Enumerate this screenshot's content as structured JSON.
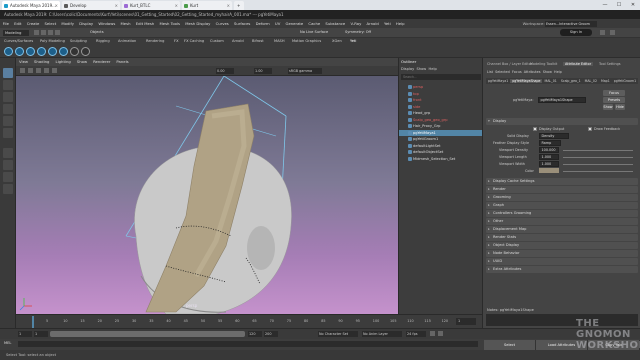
{
  "browser": {
    "tabs": [
      {
        "label": "Autodesk Maya 2019...",
        "color": "#1c9cc9",
        "active": true
      },
      {
        "label": "Develop",
        "color": "#5a5a5a",
        "active": false
      },
      {
        "label": "Kurt_BTLC",
        "color": "#9b6ad4",
        "active": false
      },
      {
        "label": "Kurt",
        "color": "#4a9b4a",
        "active": false
      }
    ],
    "controls": [
      "—",
      "☐",
      "✕"
    ]
  },
  "maya": {
    "title": "Autodesk Maya 2019: C:\\Users\\colic\\Documents\\Kurt\\Yeti\\scenes\\01_Getting_Started\\02_Getting_Started_myhairA_001.ma* --- pgYetiMaya1",
    "menu": [
      "File",
      "Edit",
      "Create",
      "Select",
      "Modify",
      "Display",
      "Windows",
      "Mesh",
      "Edit Mesh",
      "Mesh Tools",
      "Mesh Display",
      "Curves",
      "Surfaces",
      "Deform",
      "UV",
      "Generate",
      "Cache",
      "Substance",
      "V-Ray",
      "Arnold",
      "Yeti",
      "Help"
    ],
    "workspace_label": "Workspace:",
    "workspace_value": "Essen...Interactive Groom",
    "sign_in": "Sign In",
    "mode": "Modeling",
    "objects_label": "Objects",
    "no_live_surface": "No Live Surface",
    "symmetry": "Symmetry: Off",
    "shelf_tabs": [
      "Curves/Surfaces",
      "Poly Modeling",
      "Sculpting",
      "Rigging",
      "Animation",
      "Rendering",
      "FX",
      "FX Caching",
      "Custom",
      "Arnold",
      "Bifrost",
      "MASH",
      "Motion Graphics",
      "XGen",
      "Yeti"
    ]
  },
  "viewport": {
    "menu": [
      "View",
      "Shading",
      "Lighting",
      "Show",
      "Renderer",
      "Panels"
    ],
    "label": "persp",
    "colorspace": "sRGB gamma",
    "field_a": "0.00",
    "field_b": "1.00"
  },
  "outliner": {
    "title": "Outliner",
    "menu": [
      "Display",
      "Show",
      "Help"
    ],
    "search_placeholder": "Search...",
    "items": [
      {
        "label": "persp",
        "red": true,
        "selected": false
      },
      {
        "label": "top",
        "red": true,
        "selected": false
      },
      {
        "label": "front",
        "red": true,
        "selected": false
      },
      {
        "label": "side",
        "red": true,
        "selected": false
      },
      {
        "label": "Head_grp",
        "red": false,
        "selected": false
      },
      {
        "label": "Scalp_geo_geo_grp",
        "red": true,
        "selected": false
      },
      {
        "label": "Hair_Proxy_Grp",
        "red": false,
        "selected": false
      },
      {
        "label": "pgYetiMaya1",
        "red": false,
        "selected": true
      },
      {
        "label": "pgYetiGroom1",
        "red": false,
        "selected": false
      },
      {
        "label": "defaultLightSet",
        "red": false,
        "selected": false
      },
      {
        "label": "defaultObjectSet",
        "red": false,
        "selected": false
      },
      {
        "label": "Midmesh_Selection_Set",
        "red": false,
        "selected": false
      }
    ]
  },
  "attribute_editor": {
    "tabs": [
      "Channel Box / Layer Editor",
      "Modeling Toolkit",
      "Attribute Editor",
      "Tool Settings"
    ],
    "menu": [
      "List",
      "Selected",
      "Focus",
      "Attributes",
      "Show",
      "Help"
    ],
    "node_tabs": [
      "pgYetiMaya1",
      "pgYetiMayaShape",
      "MAL_01",
      "Scalp_geo_1",
      "MAL_02",
      "Map1",
      "pgYetiGroom1"
    ],
    "node_label": "pgYetiMaya:",
    "node_value": "pgYetiMaya1Shape",
    "focus_btn": "Focus",
    "presets_btn": "Presets",
    "show_btn": "Show",
    "hide_btn": "Hide",
    "display_section": "Display",
    "display_output": "Display Output",
    "draw_feedback": "Draw Feedback",
    "solid_display_label": "Solid Display",
    "solid_display_value": "Density",
    "feather_display_label": "Feather Display Style",
    "feather_display_value": "Ramp",
    "viewport_density_label": "Viewport Density",
    "viewport_density_value": "100.000",
    "viewport_length_label": "Viewport Length",
    "viewport_length_value": "1.000",
    "viewport_width_label": "Viewport Width",
    "viewport_width_value": "1.000",
    "color_label": "Color",
    "sections": [
      "Display Cache Settings",
      "Render",
      "Grooming",
      "Graph",
      "Controllers Grooming",
      "Other",
      "Displacement Map",
      "Render Stats",
      "Object Display",
      "Node Behavior",
      "UUID",
      "Extra Attributes"
    ],
    "notes_label": "Notes: pgYetiMaya1Shape",
    "bottom_buttons": [
      "Select",
      "Load Attributes",
      "Copy Tab"
    ]
  },
  "timeline": {
    "ticks": [
      "5",
      "10",
      "15",
      "20",
      "25",
      "30",
      "35",
      "40",
      "45",
      "50",
      "55",
      "60",
      "65",
      "70",
      "75",
      "80",
      "85",
      "90",
      "95",
      "100",
      "105",
      "110",
      "115",
      "120"
    ],
    "current_frame": "1",
    "start": "1",
    "end": "120",
    "range_start": "1",
    "range_end": "120",
    "range_end2": "200",
    "character_set": "No Character Set",
    "anim_layer": "No Anim Layer",
    "fps": "24 fps"
  },
  "command_line": {
    "mel": "MEL",
    "help_text": "Select Tool: select an object"
  },
  "watermark": "THE GNOMON WORKSHOP",
  "colors": {
    "accent": "#5285a6",
    "viewport_top": "#5b5b72",
    "viewport_bottom": "#c592cc"
  }
}
